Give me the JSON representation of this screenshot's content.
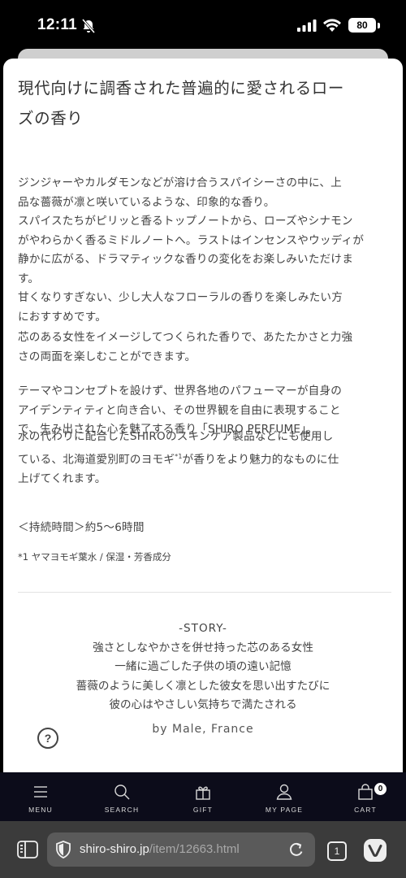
{
  "status": {
    "time": "12:11",
    "battery": "80"
  },
  "content": {
    "title_lines": [
      "現代向けに調香された普遍的に愛されるロー",
      "ズの香り"
    ],
    "p1": [
      "ジンジャーやカルダモンなどが溶け合うスパイシーさの中に、上",
      "品な薔薇が凛と咲いているような、印象的な香り。",
      "スパイスたちがピリッと香るトップノートから、ローズやシナモン",
      "がやわらかく香るミドルノートへ。ラストはインセンスやウッディが",
      "静かに広がる、ドラマティックな香りの変化をお楽しみいただけま",
      "す。",
      "甘くなりすぎない、少し大人なフローラルの香りを楽しみたい方",
      "におすすめです。"
    ],
    "p2": [
      "芯のある女性をイメージしてつくられた香りで、あたたかさと力強",
      "さの両面を楽しむことができます。"
    ],
    "p3": [
      "テーマやコンセプトを設けず、世界各地のパフューマーが自身の",
      "アイデンティティと向き合い、その世界観を自由に表現すること",
      "で、生み出された心を魅了する香り「SHIRO PERFUME」。"
    ],
    "p4_line1": "水の代わりに配合したSHIROのスキンケア製品などにも使用し",
    "p4_line2_a": "ている、北海道愛別町のヨモギ",
    "p4_line2_sup": "*1",
    "p4_line2_b": "が香りをより魅力的なものに仕",
    "p4_line3": "上げてくれます。",
    "duration": "＜持続時間＞約5〜6時間",
    "footnote": "*1 ヤマヨモギ葉水 / 保湿・芳香成分",
    "story_title": "-STORY-",
    "story_lines": [
      "強さとしなやかさを併せ持った芯のある女性",
      "一緒に過ごした子供の頃の遠い記憶",
      "薔薇のように美しく凛とした彼女を思い出すたびに",
      "彼の心はやさしい気持ちで満たされる"
    ],
    "author": "by Male, France",
    "help_symbol": "?"
  },
  "bottom_nav": {
    "items": [
      {
        "label": "MENU",
        "icon": "menu-icon"
      },
      {
        "label": "SEARCH",
        "icon": "search-icon"
      },
      {
        "label": "GIFT",
        "icon": "gift-icon"
      },
      {
        "label": "MY PAGE",
        "icon": "user-icon"
      },
      {
        "label": "CART",
        "icon": "bag-icon"
      }
    ],
    "cart_count": "0"
  },
  "browser": {
    "url_domain": "shiro-shiro.jp",
    "url_path": "/item/12663.html",
    "tab_count": "1"
  }
}
